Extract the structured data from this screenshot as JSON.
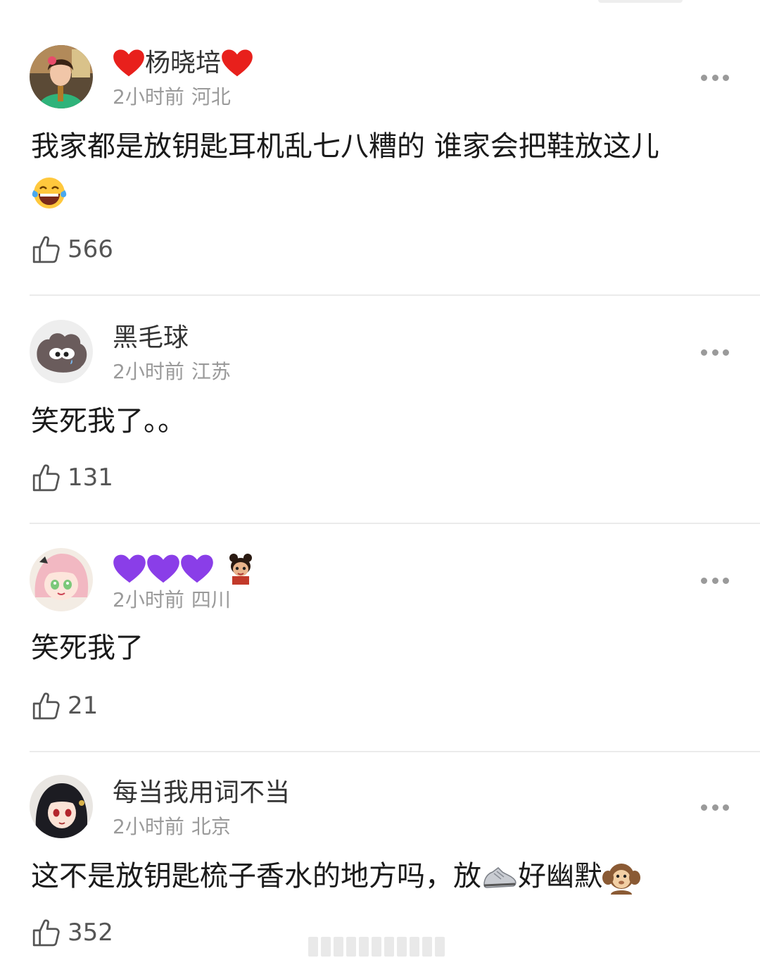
{
  "comments": [
    {
      "name": "杨晓培",
      "time": "2小时前",
      "location": "河北",
      "text": "我家都是放钥匙耳机乱七八糟的 谁家会把鞋放这儿",
      "likes": "566"
    },
    {
      "name": "黑毛球",
      "time": "2小时前",
      "location": "江苏",
      "text": "笑死我了。。",
      "likes": "131"
    },
    {
      "name": "",
      "time": "2小时前",
      "location": "四川",
      "text": "笑死我了",
      "likes": "21"
    },
    {
      "name": "每当我用词不当",
      "time": "2小时前",
      "location": "北京",
      "text_part1": "这不是放钥匙梳子香水的地方吗，放",
      "text_part2": "好幽默",
      "likes": "352"
    }
  ],
  "icons": {
    "more": "more-icon",
    "like": "thumbs-up-icon",
    "name_deco_red": "red-heart-icon",
    "name_deco_purple": "purple-heart-icon",
    "name_deco_character": "cartoon-character-icon",
    "laugh": "tears-of-joy-emoji",
    "shoe": "sneaker-emoji",
    "monkey": "hear-no-evil-monkey-emoji"
  },
  "colors": {
    "name": "#333333",
    "meta": "#9a9a9a",
    "divider": "#ebebeb",
    "red_heart": "#e8201c",
    "purple_heart": "#8a3ee8"
  }
}
